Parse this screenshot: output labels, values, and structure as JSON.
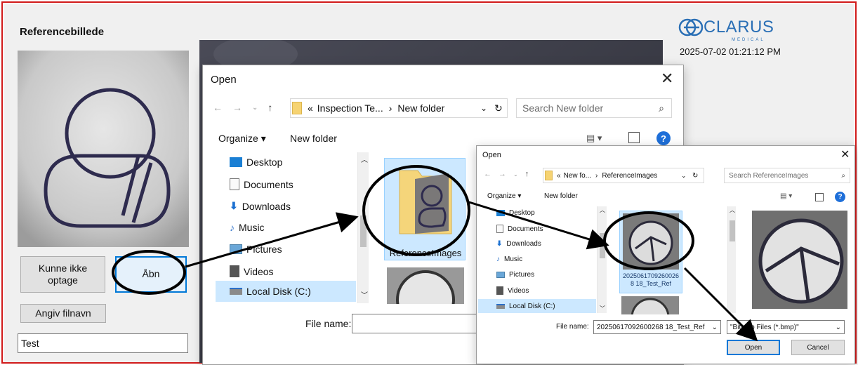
{
  "app": {
    "left_title": "Referencebillede",
    "btn_kunne_ikke": "Kunne ikke optage",
    "btn_abn": "Åbn",
    "btn_angiv": "Angiv filnavn",
    "filename_value": "Test",
    "logo": "CLARUS",
    "logo_sub": "MEDICAL",
    "timestamp": "2025-07-02 01:21:12 PM"
  },
  "dialog1": {
    "title": "Open",
    "breadcrumb_prefix": "«",
    "breadcrumb_1": "Inspection Te...",
    "breadcrumb_sep": "›",
    "breadcrumb_2": "New folder",
    "search_placeholder": "Search New folder",
    "organize": "Organize ▾",
    "new_folder": "New folder",
    "nav_items": [
      "Desktop",
      "Documents",
      "Downloads",
      "Music",
      "Pictures",
      "Videos",
      "Local Disk (C:)"
    ],
    "folder_name": "ReferenceImages",
    "file_name_label": "File name:"
  },
  "dialog2": {
    "title": "Open",
    "breadcrumb_prefix": "«",
    "breadcrumb_1": "New fo...",
    "breadcrumb_sep": "›",
    "breadcrumb_2": "ReferenceImages",
    "search_placeholder": "Search ReferenceImages",
    "organize": "Organize ▾",
    "new_folder": "New folder",
    "nav_items": [
      "Desktop",
      "Documents",
      "Downloads",
      "Music",
      "Pictures",
      "Videos",
      "Local Disk (C:)"
    ],
    "file_tile_name": "20250617092600268 18_Test_Ref",
    "file_name_label": "File name:",
    "file_name_value": "20250617092600268 18_Test_Ref",
    "file_type": "\"Bitmap Files (*.bmp)\"",
    "open_button": "Open",
    "cancel_button": "Cancel"
  },
  "colors": {
    "frame": "#d11a1a",
    "accent": "#0078d7",
    "selection": "#cce8ff",
    "logo": "#2a6fb5"
  }
}
